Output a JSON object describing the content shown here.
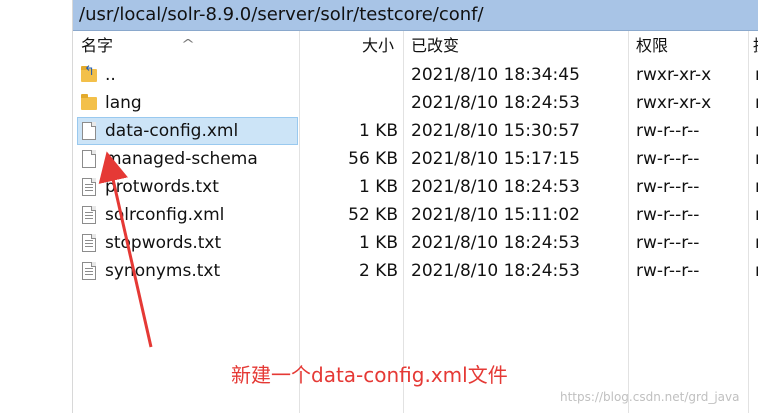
{
  "path_bar": {
    "path": "/usr/local/solr-8.9.0/server/solr/testcore/conf/"
  },
  "columns": {
    "name": "名字",
    "size": "大小",
    "modified": "已改变",
    "permissions": "权限",
    "extra": "拥"
  },
  "files": [
    {
      "icon": "folder-up-icon",
      "name": "..",
      "size": "",
      "modified": "2021/8/10 18:34:45",
      "permissions": "rwxr-xr-x",
      "extra": "r"
    },
    {
      "icon": "folder-icon",
      "name": "lang",
      "size": "",
      "modified": "2021/8/10 18:24:53",
      "permissions": "rwxr-xr-x",
      "extra": "r"
    },
    {
      "icon": "file-icon",
      "name": "data-config.xml",
      "size": "1 KB",
      "modified": "2021/8/10 15:30:57",
      "permissions": "rw-r--r--",
      "extra": "r",
      "selected": true
    },
    {
      "icon": "file-icon",
      "name": "managed-schema",
      "size": "56 KB",
      "modified": "2021/8/10 15:17:15",
      "permissions": "rw-r--r--",
      "extra": "r"
    },
    {
      "icon": "text-file-icon",
      "name": "protwords.txt",
      "size": "1 KB",
      "modified": "2021/8/10 18:24:53",
      "permissions": "rw-r--r--",
      "extra": "r"
    },
    {
      "icon": "text-file-icon",
      "name": "solrconfig.xml",
      "size": "52 KB",
      "modified": "2021/8/10 15:11:02",
      "permissions": "rw-r--r--",
      "extra": "r"
    },
    {
      "icon": "text-file-icon",
      "name": "stopwords.txt",
      "size": "1 KB",
      "modified": "2021/8/10 18:24:53",
      "permissions": "rw-r--r--",
      "extra": "r"
    },
    {
      "icon": "text-file-icon",
      "name": "synonyms.txt",
      "size": "2 KB",
      "modified": "2021/8/10 18:24:53",
      "permissions": "rw-r--r--",
      "extra": "r"
    }
  ],
  "annotation": {
    "text": "新建一个data-config.xml文件",
    "color": "#e53935"
  },
  "watermark": {
    "text": "https://blog.csdn.net/grd_java"
  },
  "colors": {
    "path_bar_bg": "#a8c4e6",
    "selection_bg": "#cce4f7",
    "annotation": "#e53935"
  }
}
